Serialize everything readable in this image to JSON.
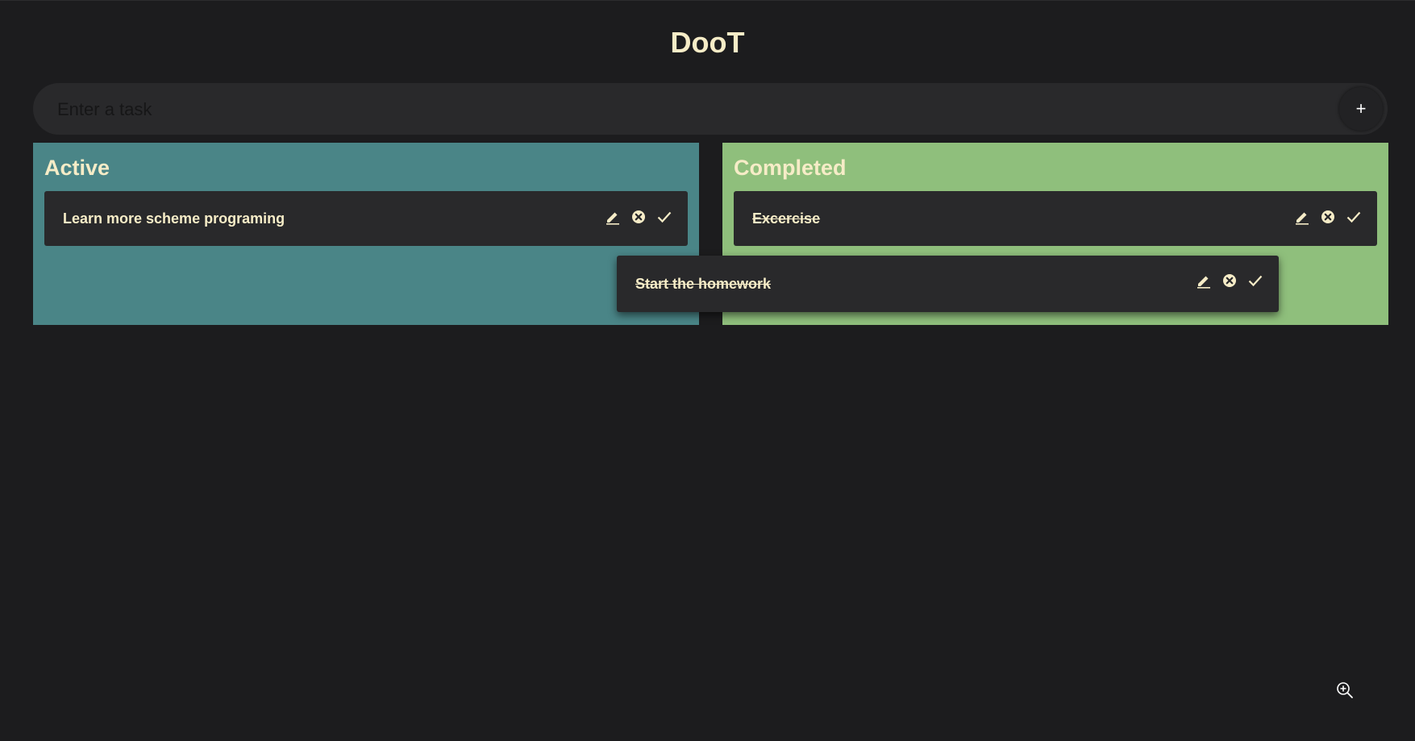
{
  "app": {
    "title": "DooT"
  },
  "task_form": {
    "placeholder": "Enter a task",
    "value": "",
    "add_label": "+"
  },
  "columns": {
    "active": {
      "title": "Active",
      "color": "#4a8587",
      "tasks": [
        {
          "text": "Learn more scheme programing",
          "completed": false
        }
      ]
    },
    "completed": {
      "title": "Completed",
      "color": "#8fbf7c",
      "tasks": [
        {
          "text": "Excercise",
          "completed": true
        }
      ]
    }
  },
  "dragging_task": {
    "text": "Start the homework",
    "completed": true
  },
  "task_actions": [
    "pencil-icon",
    "close-circle-icon",
    "check-icon"
  ],
  "colors": {
    "background": "#1c1c1e",
    "card": "#29292b",
    "text": "#f6ecc7"
  },
  "icons": {
    "zoom": "zoom-in-icon"
  }
}
